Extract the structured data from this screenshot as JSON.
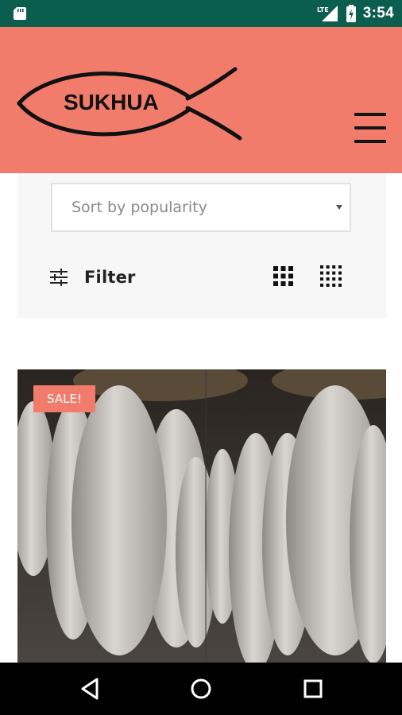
{
  "status_bar": {
    "time": "3:54",
    "network": "LTE",
    "icons": [
      "sd-card-icon",
      "signal-icon",
      "battery-charging-icon"
    ]
  },
  "header": {
    "logo_text": "SUKHUA",
    "background_color": "#f27c6b",
    "menu_icon": "hamburger-menu-icon"
  },
  "shop_toolbar": {
    "sort_select": {
      "selected": "Sort by popularity"
    },
    "filter_label": "Filter",
    "view_options": [
      "grid-3-view-icon",
      "grid-4-view-icon"
    ]
  },
  "products": [
    {
      "badge": "SALE!",
      "badge_color": "#f27c6b",
      "image": "dried-fish-photo"
    }
  ],
  "nav_bar": {
    "buttons": [
      "back-icon",
      "home-icon",
      "recents-icon"
    ]
  }
}
